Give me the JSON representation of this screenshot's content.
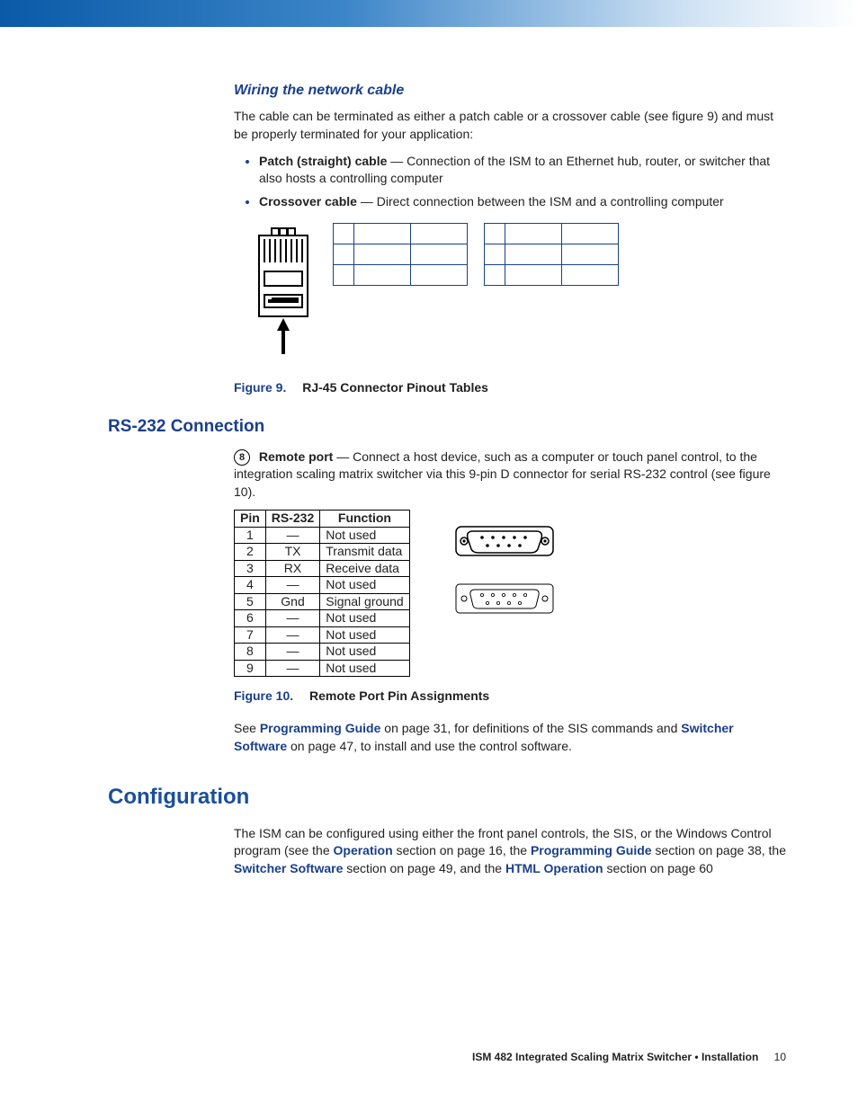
{
  "wiring": {
    "heading": "Wiring the network cable",
    "intro": "The cable can be terminated as either a patch cable or a crossover cable (see figure 9) and must be properly terminated for your application:",
    "bullet1_bold": "Patch (straight) cable",
    "bullet1_rest": " — Connection of the ISM to an Ethernet hub, router, or switcher that also hosts a controlling computer",
    "bullet2_bold": "Crossover cable",
    "bullet2_rest": " — Direct connection between the ISM and a controlling computer"
  },
  "figure9": {
    "label": "Figure 9.",
    "title": "RJ-45 Connector Pinout Tables"
  },
  "rs232": {
    "heading": "RS-232 Connection",
    "step_num": "8",
    "step_bold": "Remote port",
    "step_rest": " — Connect a host device, such as a computer or touch panel control, to the integration scaling matrix switcher via this 9-pin D connector for serial RS-232 control (see figure 10).",
    "headers": [
      "Pin",
      "RS-232",
      "Function"
    ],
    "rows": [
      {
        "pin": "1",
        "rs": "—",
        "fn": "Not used"
      },
      {
        "pin": "2",
        "rs": "TX",
        "fn": "Transmit data"
      },
      {
        "pin": "3",
        "rs": "RX",
        "fn": "Receive data"
      },
      {
        "pin": "4",
        "rs": "—",
        "fn": "Not used"
      },
      {
        "pin": "5",
        "rs": "Gnd",
        "fn": "Signal ground"
      },
      {
        "pin": "6",
        "rs": "—",
        "fn": "Not used"
      },
      {
        "pin": "7",
        "rs": "—",
        "fn": "Not used"
      },
      {
        "pin": "8",
        "rs": "—",
        "fn": "Not used"
      },
      {
        "pin": "9",
        "rs": "—",
        "fn": "Not used"
      }
    ]
  },
  "figure10": {
    "label": "Figure 10.",
    "title": "Remote Port Pin Assignments"
  },
  "see_line": {
    "pre": "See ",
    "link1": "Programming Guide",
    "mid1": " on page 31, for definitions of the SIS commands and ",
    "link2": "Switcher Software",
    "mid2": " on page 47, to install and use the control software."
  },
  "config": {
    "heading": "Configuration",
    "pre": "The ISM can be configured using either the front panel controls, the SIS, or the Windows Control program (see the ",
    "link1": "Operation",
    "mid1": " section on page 16, the ",
    "link2": "Programming Guide",
    "mid2": " section on page 38, the ",
    "link3": "Switcher Software",
    "mid3": " section on page 49, and the ",
    "link4": "HTML Operation",
    "mid4": " section on page 60"
  },
  "footer": {
    "text": "ISM 482 Integrated Scaling Matrix Switcher • Installation",
    "page": "10"
  }
}
